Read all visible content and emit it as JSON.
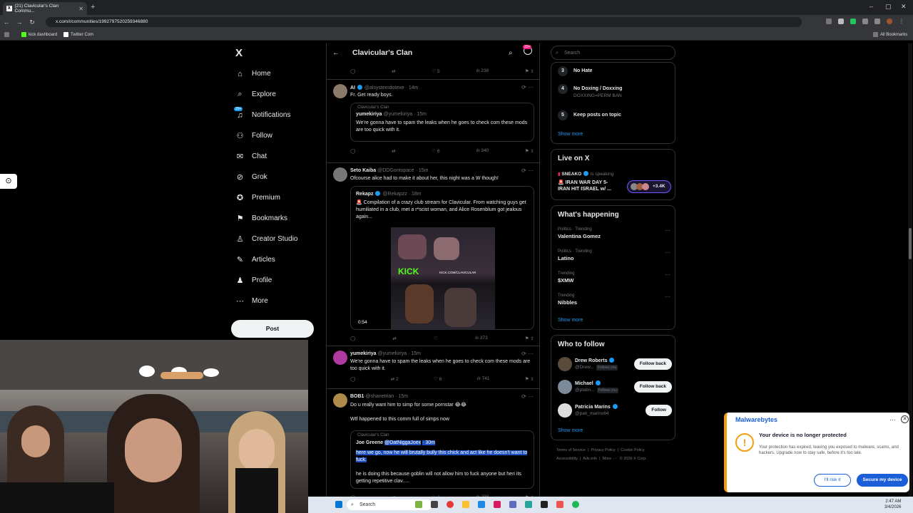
{
  "browser": {
    "tab_title": "(21) Clavicular's Clan Commu...",
    "tab_favicon": "X",
    "url": "x.com/i/communities/1992797520259346880",
    "bookmarks": [
      "kick dashboard",
      "Twitter Com"
    ],
    "all_bookmarks": "All Bookmarks"
  },
  "leftnav": {
    "logo": "X",
    "items": [
      {
        "label": "Home",
        "icon": "home-icon"
      },
      {
        "label": "Explore",
        "icon": "search-icon"
      },
      {
        "label": "Notifications",
        "icon": "bell-icon",
        "badge": "20+"
      },
      {
        "label": "Follow",
        "icon": "add-person-icon"
      },
      {
        "label": "Chat",
        "icon": "mail-icon"
      },
      {
        "label": "Grok",
        "icon": "grok-icon"
      },
      {
        "label": "Premium",
        "icon": "premium-icon"
      },
      {
        "label": "Bookmarks",
        "icon": "bookmark-icon"
      },
      {
        "label": "Creator Studio",
        "icon": "creator-icon"
      },
      {
        "label": "Articles",
        "icon": "articles-icon"
      },
      {
        "label": "Profile",
        "icon": "profile-icon"
      },
      {
        "label": "More",
        "icon": "more-icon"
      }
    ],
    "post_button": "Post"
  },
  "feed": {
    "title": "Clavicular's Clan",
    "badge": "20+",
    "top_actions": {
      "likes": "5",
      "views": "238"
    },
    "tweets": [
      {
        "name": "AI",
        "handle": "@alsystemdotexe",
        "time": "· 14m",
        "text": "Fr. Get ready boys.",
        "quote": {
          "community": "Clavicular's Clan",
          "name": "yumekiriya",
          "handle": "@yumekiriya",
          "time": "· 15m",
          "text": "We're gonna have to spam the leaks when he goes to check com these mods are too quick with it."
        },
        "likes": "6",
        "views": "340"
      },
      {
        "name": "Seto Kaiba",
        "handle": "@DDGontopace",
        "time": "· 15m",
        "text": "Ofcourse alice had to make it about her, this night was a W though!",
        "quote": {
          "name": "Rekapz",
          "handle": "@Rekapzz",
          "time": "· 18m",
          "text": "🚨 Compilation of a crazy club stream for Clavicular. From watching guys get humiliated in a club, met a r*scist woman, and Alice Rosenblum got jealous again...",
          "video_time": "0:54",
          "overlay": "KICK",
          "overlay2": "KICK.COM/CLAVICULAR"
        },
        "views": "373"
      },
      {
        "name": "yumekiriya",
        "handle": "@yumekiriya",
        "time": "· 15m",
        "text": "We're gonna have to spam the leaks when he goes to check com these mods are too quick with it.",
        "retweets": "2",
        "likes": "6",
        "views": "741"
      },
      {
        "name": "BOB1",
        "handle": "@shanetrian",
        "time": "· 15m",
        "text": "Do u really want him to simp for some pornstar 😂😂",
        "text2": "Wtf happened to this comm full of simps now",
        "quote": {
          "community": "Clavicular's Clan",
          "name": "Joe Greene",
          "handle": "@DatNiggaJoex",
          "time": "· 30m",
          "text_highlight": "here we go, now he will brutally bully this chick and act like he doesn't want to fuck.",
          "text2": "he is doing this because goblin will not allow him to fuck anyone but heri its getting repetitive clav....."
        },
        "retweets": "2",
        "views": "298"
      }
    ]
  },
  "rightbar": {
    "search_placeholder": "Search",
    "rules": [
      {
        "n": "3",
        "title": "No Hate",
        "sub": ""
      },
      {
        "n": "4",
        "title": "No Doxing / Doxxing",
        "sub": "DOXXING=PERM BAN"
      },
      {
        "n": "5",
        "title": "Keep posts on topic",
        "sub": ""
      }
    ],
    "show_more": "Show more",
    "live": {
      "title": "Live on X",
      "host": "SNEAKO",
      "status": "is speaking",
      "headline": "🚨 IRAN WAR DAY 5- IRAN HIT ISRAEL w/ ...",
      "listeners": "+3.4K"
    },
    "happening": {
      "title": "What's happening",
      "trends": [
        {
          "cat": "Politics · Trending",
          "name": "Valentina Gomez"
        },
        {
          "cat": "Politics · Trending",
          "name": "Latino"
        },
        {
          "cat": "Trending",
          "name": "$XMW"
        },
        {
          "cat": "Trending",
          "name": "Nibbles"
        }
      ]
    },
    "who_to_follow": {
      "title": "Who to follow",
      "people": [
        {
          "name": "Drew Roberts",
          "handle": "@Drew...",
          "follows_you": "Follows you",
          "button": "Follow back"
        },
        {
          "name": "Michael",
          "handle": "@platin...",
          "follows_you": "Follows you",
          "button": "Follow back"
        },
        {
          "name": "Patricia Marins",
          "handle": "@pati_marins64",
          "follows_you": "",
          "button": "Follow"
        }
      ]
    },
    "footer": [
      "Terms of Service",
      "Privacy Policy",
      "Cookie Policy",
      "Accessibility",
      "Ads info",
      "More ···",
      "© 2026 X Corp."
    ]
  },
  "malwarebytes": {
    "brand": "Malwarebytes",
    "title": "Your device is no longer protected",
    "text": "Your protection has expired, leaving you exposed to malware, scams, and hackers. Upgrade now to stay safe, before it's too late.",
    "risk_button": "I'll risk it",
    "secure_button": "Secure my device"
  },
  "taskbar": {
    "search": "Search",
    "time": "2:47 AM",
    "date": "3/4/2026"
  },
  "colors": {
    "accent": "#1d9bf0",
    "bg": "#000000",
    "border": "#2f3336",
    "mb_blue": "#1a5ed8",
    "mb_orange": "#f59e0b"
  }
}
